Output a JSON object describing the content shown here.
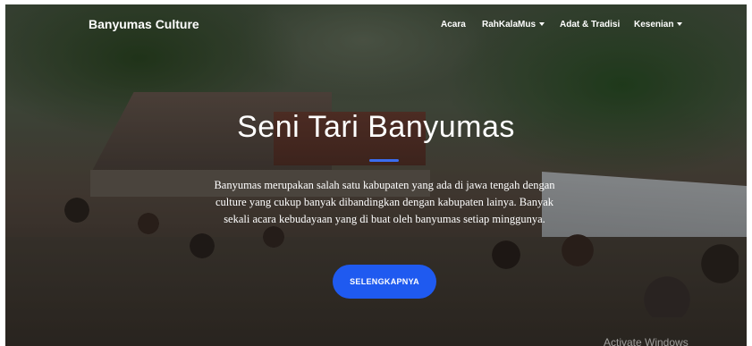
{
  "navbar": {
    "brand": "Banyumas Culture",
    "items": [
      {
        "label": "Acara",
        "dropdown": false
      },
      {
        "label": "RahKalaMus",
        "dropdown": true
      },
      {
        "label": "Adat & Tradisi",
        "dropdown": false
      },
      {
        "label": "Kesenian",
        "dropdown": true
      }
    ]
  },
  "hero": {
    "title": "Seni Tari Banyumas",
    "description": "Banyumas merupakan salah satu kabupaten yang ada di jawa tengah dengan culture yang cukup banyak dibandingkan dengan kabupaten lainya. Banyak sekali acara kebudayaan yang di buat oleh banyumas setiap minggunya.",
    "cta_label": "SELENGKAPNYA",
    "accent_color": "#1f5af0"
  },
  "watermark": "Activate Windows"
}
